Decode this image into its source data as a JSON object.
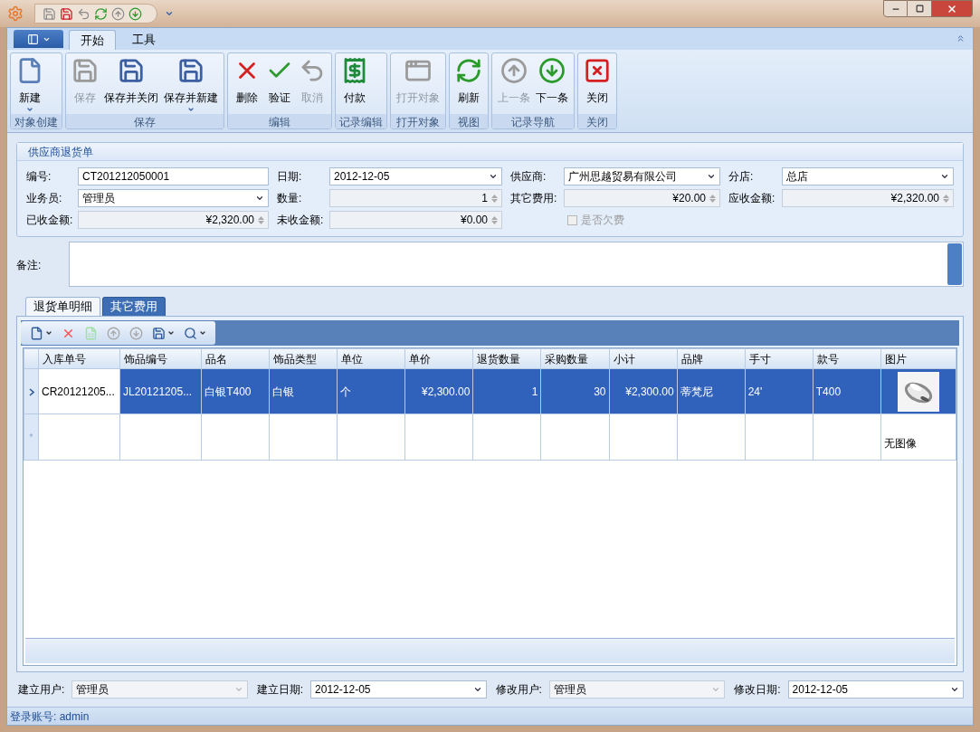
{
  "window": {
    "quick_access": [
      {
        "disabled": true
      },
      {
        "disabled": false
      },
      {
        "disabled": true
      },
      {
        "disabled": false
      },
      {
        "disabled": true
      },
      {
        "disabled": false
      }
    ]
  },
  "ribbon": {
    "tabs": [
      {
        "label": "开始",
        "selected": true
      },
      {
        "label": "工具",
        "selected": false
      }
    ],
    "groups": [
      {
        "caption": "对象创建",
        "buttons": [
          {
            "label": "新建",
            "disabled": false,
            "dropdown": true
          }
        ]
      },
      {
        "caption": "保存",
        "buttons": [
          {
            "label": "保存",
            "disabled": true,
            "dropdown": false
          },
          {
            "label": "保存并关闭",
            "disabled": false,
            "dropdown": false
          },
          {
            "label": "保存并新建",
            "disabled": false,
            "dropdown": true
          }
        ]
      },
      {
        "caption": "编辑",
        "buttons": [
          {
            "label": "删除",
            "disabled": false,
            "dropdown": false
          },
          {
            "label": "验证",
            "disabled": false,
            "dropdown": false
          },
          {
            "label": "取消",
            "disabled": true,
            "dropdown": false
          }
        ]
      },
      {
        "caption": "记录编辑",
        "buttons": [
          {
            "label": "付款",
            "disabled": false,
            "dropdown": false
          }
        ]
      },
      {
        "caption": "打开对象",
        "buttons": [
          {
            "label": "打开对象",
            "disabled": true,
            "dropdown": false
          }
        ]
      },
      {
        "caption": "视图",
        "buttons": [
          {
            "label": "刷新",
            "disabled": false,
            "dropdown": false
          }
        ]
      },
      {
        "caption": "记录导航",
        "buttons": [
          {
            "label": "上一条",
            "disabled": true,
            "dropdown": false
          },
          {
            "label": "下一条",
            "disabled": false,
            "dropdown": false
          }
        ]
      },
      {
        "caption": "关闭",
        "buttons": [
          {
            "label": "关闭",
            "disabled": false,
            "dropdown": false
          }
        ]
      }
    ]
  },
  "form": {
    "title": "供应商退货单",
    "fields": [
      {
        "label": "编号:",
        "value": "CT201212050001",
        "kind": "text",
        "disabled": false
      },
      {
        "label": "日期:",
        "value": "2012-12-05",
        "kind": "combo",
        "disabled": false
      },
      {
        "label": "供应商:",
        "value": "广州思越贸易有限公司",
        "kind": "combo",
        "disabled": false
      },
      {
        "label": "分店:",
        "value": "总店",
        "kind": "combo",
        "disabled": false
      },
      {
        "label": "业务员:",
        "value": "管理员",
        "kind": "combo",
        "disabled": false
      },
      {
        "label": "数量:",
        "value": "1",
        "kind": "spin",
        "disabled": true
      },
      {
        "label": "其它费用:",
        "value": "¥20.00",
        "kind": "spin",
        "disabled": true
      },
      {
        "label": "应收金额:",
        "value": "¥2,320.00",
        "kind": "spin",
        "disabled": true
      },
      {
        "label": "已收金额:",
        "value": "¥2,320.00",
        "kind": "spin",
        "disabled": true
      },
      {
        "label": "未收金额:",
        "value": "¥0.00",
        "kind": "spin",
        "disabled": true
      },
      {
        "label": "是否欠费",
        "kind": "checkbox",
        "checked": false,
        "disabled": true
      }
    ]
  },
  "memo": {
    "label": "备注:"
  },
  "detail_tabs": [
    {
      "label": "退货单明细",
      "selected": true
    },
    {
      "label": "其它费用",
      "selected": false
    }
  ],
  "grid_toolbar": [
    {
      "disabled": false,
      "dropdown": true
    },
    {
      "disabled": false,
      "dropdown": false
    },
    {
      "disabled": false,
      "dropdown": false
    },
    {
      "disabled": true,
      "dropdown": false
    },
    {
      "disabled": true,
      "dropdown": false
    },
    {
      "disabled": false,
      "dropdown": true
    },
    {
      "disabled": false,
      "dropdown": true
    }
  ],
  "table": {
    "columns": [
      {
        "label": "入库单号",
        "kind": "text"
      },
      {
        "label": "饰品编号",
        "kind": "text"
      },
      {
        "label": "品名",
        "kind": "text"
      },
      {
        "label": "饰品类型",
        "kind": "text"
      },
      {
        "label": "单位",
        "kind": "text"
      },
      {
        "label": "单价",
        "kind": "number"
      },
      {
        "label": "退货数量",
        "kind": "number"
      },
      {
        "label": "采购数量",
        "kind": "number"
      },
      {
        "label": "小计",
        "kind": "number"
      },
      {
        "label": "品牌",
        "kind": "text"
      },
      {
        "label": "手寸",
        "kind": "text"
      },
      {
        "label": "款号",
        "kind": "text"
      },
      {
        "label": "图片"
      }
    ],
    "rows": [
      {
        "selected": true,
        "cells": [
          "CR20121205...",
          "JL20121205...",
          "白银T400",
          "白银",
          "个",
          "¥2,300.00",
          "1",
          "30",
          "¥2,300.00",
          "蒂梵尼",
          "24'",
          "T400",
          {
            "kind": "picture"
          }
        ]
      }
    ],
    "new_row": {
      "marker": "*",
      "image_placeholder": "无图像"
    }
  },
  "footer": [
    {
      "label": "建立用户:",
      "value": "管理员",
      "disabled": true
    },
    {
      "label": "建立日期:",
      "value": "2012-12-05",
      "disabled": false
    },
    {
      "label": "修改用户:",
      "value": "管理员",
      "disabled": true
    },
    {
      "label": "修改日期:",
      "value": "2012-12-05",
      "disabled": false
    }
  ],
  "status_bar": {
    "text": "登录账号: admin"
  }
}
